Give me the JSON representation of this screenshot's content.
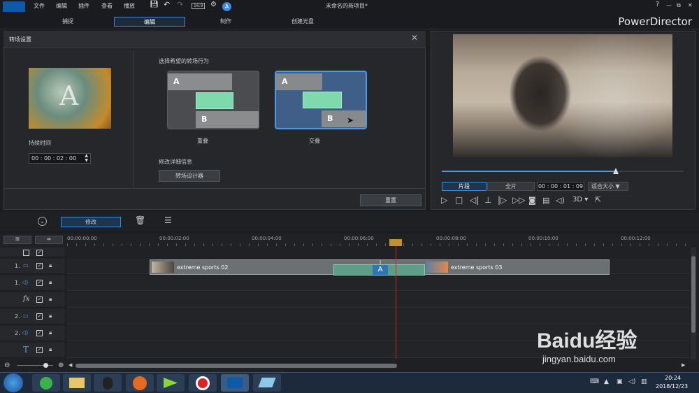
{
  "titlebar": {
    "menus": [
      "文件",
      "编辑",
      "插件",
      "查看",
      "播放"
    ],
    "title": "未命名的新项目*",
    "help": "?",
    "window_controls": [
      "—",
      "⧉",
      "✕"
    ]
  },
  "modes": [
    {
      "label": "捕捉"
    },
    {
      "label": "编辑",
      "active": true
    },
    {
      "label": "制作"
    },
    {
      "label": "创建光盘"
    }
  ],
  "brand": "PowerDirector",
  "transition": {
    "panel_title": "转场设置",
    "thumb_letter": "A",
    "duration_label": "持续时间",
    "duration_value": "00 : 00 : 02 : 00",
    "behavior_label": "选择希望的转场行为",
    "option_overlap": "重叠",
    "option_cross": "交叠",
    "modify_label": "修改详细信息",
    "designer_button": "转场设计器",
    "reset_button": "重置",
    "letter_a": "A",
    "letter_b": "B"
  },
  "preview": {
    "btn_clip": "片段",
    "btn_full": "全片",
    "timecode": "00 : 00 : 01 : 09",
    "fit": "适合大小 ▼",
    "mode3d": "3D ▾",
    "scrub_position": 0.72
  },
  "toolbar": {
    "modify_button": "修改"
  },
  "ruler": [
    "00:00:00:00",
    "00:00:02:00",
    "00:00:04:00",
    "00:00:06:00",
    "00:00:08:00",
    "00:00:10:00",
    "00:00:12:00"
  ],
  "tracks": [
    {
      "num": "",
      "icon": "▭"
    },
    {
      "num": "1.",
      "icon": "▭"
    },
    {
      "num": "1.",
      "icon": "◁)"
    },
    {
      "num": "",
      "icon": "fx"
    },
    {
      "num": "2.",
      "icon": "▭"
    },
    {
      "num": "2.",
      "icon": "◁)"
    },
    {
      "num": "",
      "icon": "T"
    }
  ],
  "clips": {
    "clip1": "extreme sports 02",
    "clip2": "extreme sports 03",
    "transition_letter": "A"
  },
  "taskbar": {
    "time": "20:24",
    "date": "2018/12/23"
  },
  "watermark": {
    "brand": "Baidu经验",
    "url": "jingyan.baidu.com"
  },
  "colors": {
    "accent": "#3a8ae0",
    "playhead": "#c0282b",
    "transition_green": "#7ed9ad"
  }
}
